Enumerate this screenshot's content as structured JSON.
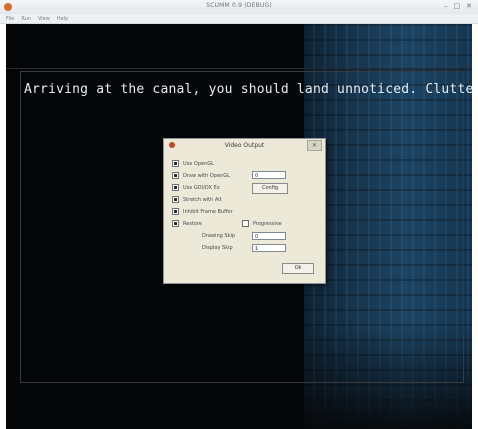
{
  "window": {
    "title": "SCUMM 0.9 (DEBUG)",
    "controls": [
      "–",
      "□",
      "✕"
    ],
    "menu": [
      "File",
      "Run",
      "View",
      "Help"
    ]
  },
  "game": {
    "caption": "Arriving at the canal, you should land unnoticed. Clutter wil"
  },
  "dialog": {
    "title": "Video Output",
    "close_label": "✕",
    "options": [
      {
        "label": "Use OpenGL",
        "checked": true
      },
      {
        "label": "Draw with OpenGL",
        "checked": true,
        "value": "0"
      },
      {
        "label": "Use GDI/DX Ex",
        "checked": true,
        "button": "Config"
      },
      {
        "label": "Stretch with Alt",
        "checked": true
      },
      {
        "label": "Inhibit Frame Buffer",
        "checked": true
      },
      {
        "label": "Restore",
        "checked": true,
        "extra_label": "Progressive",
        "extra_checked": false
      }
    ],
    "drawing_skip_label": "Drawing Skip",
    "drawing_skip_value": "0",
    "display_skip_label": "Display Skip",
    "display_skip_value": "1",
    "ok_label": "Ok"
  },
  "colors": {
    "background": "#050607",
    "caption": "#e6ecf2",
    "dialog": "#ece9d8",
    "building": "#1d4462"
  }
}
